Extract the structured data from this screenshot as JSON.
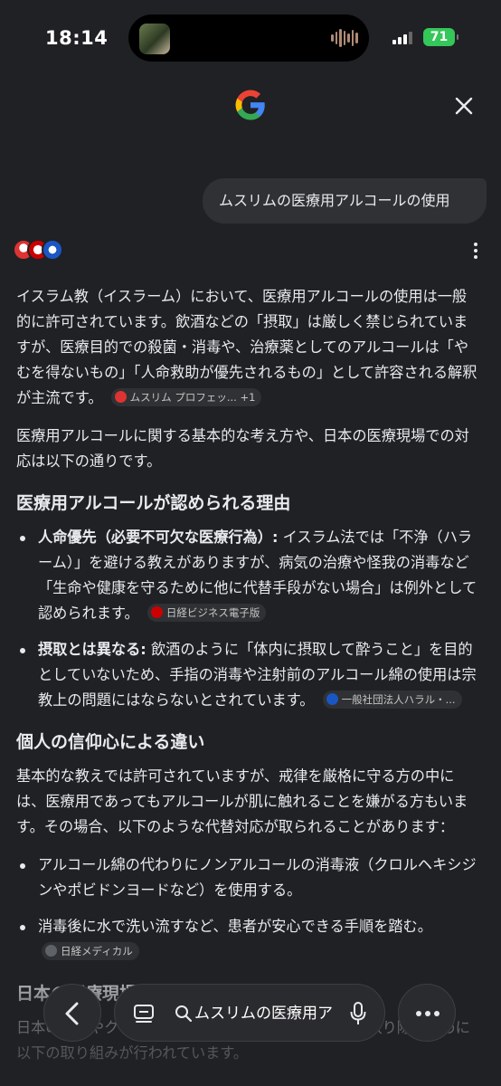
{
  "status_bar": {
    "time": "18:14",
    "battery": "71"
  },
  "header": {
    "logo": "google-g-logo",
    "close_icon": "close-icon"
  },
  "query": "ムスリムの医療用アルコールの使用",
  "answer": {
    "intro": "イスラム教（イスラーム）において、医療用アルコールの使用は一般的に許可されています。飲酒などの「摂取」は厳しく禁じられていますが、医療目的での殺菌・消毒や、治療薬としてのアルコールは「やむを得ないもの」「人命救助が優先されるもの」として許容される解釈が主流です。",
    "intro_chip": "ムスリム プロフェッ...",
    "intro_chip_count": "+1",
    "lead": "医療用アルコールに関する基本的な考え方や、日本の医療現場での対応は以下の通りです。",
    "section1_title": "医療用アルコールが認められる理由",
    "section1_items": [
      {
        "label": "人命優先（必要不可欠な医療行為）:",
        "text": "イスラム法では「不浄（ハラーム）」を避ける教えがありますが、病気の治療や怪我の消毒など「生命や健康を守るために他に代替手段がない場合」は例外として認められます。",
        "chip": "日経ビジネス電子版"
      },
      {
        "label": "摂取とは異なる:",
        "text": "飲酒のように「体内に摂取して酔うこと」を目的としていないため、手指の消毒や注射前のアルコール綿の使用は宗教上の問題にはならないとされています。",
        "chip": "一般社団法人ハラル・..."
      }
    ],
    "section2_title": "個人の信仰心による違い",
    "section2_body": "基本的な教えでは許可されていますが、戒律を厳格に守る方の中には、医療用であってもアルコールが肌に触れることを嫌がる方もいます。その場合、以下のような代替対応が取られることがあります：",
    "section2_items": [
      {
        "text": "アルコール綿の代わりにノンアルコールの消毒液（クロルヘキシジンやポビドンヨードなど）を使用する。"
      },
      {
        "text": "消毒後に水で洗い流すなど、患者が安心できる手順を踏む。",
        "chip": "日経メディカル"
      }
    ],
    "section3_title": "日本の医療現場での配慮",
    "section3_body": "日本の病院やクリニックでは、ムスリム患者の不安を取り除くために以下の取り組みが行われています。"
  },
  "bottom_bar": {
    "search_text": "ムスリムの医療用ア",
    "back_icon": "back-arrow-icon",
    "tabs_icon": "tabs-icon",
    "search_icon": "search-icon",
    "mic_icon": "mic-icon",
    "more_icon": "more-horizontal-icon"
  },
  "colors": {
    "background": "#202124",
    "surface": "#303134",
    "text": "#e8eaed",
    "battery": "#34c759"
  }
}
